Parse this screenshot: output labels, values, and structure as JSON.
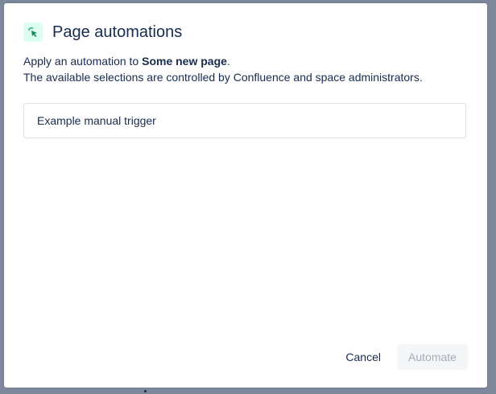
{
  "dialog": {
    "title": "Page automations",
    "icon": "automation-cursor-icon",
    "description_prefix": "Apply an automation to ",
    "page_name": "Some new page",
    "description_suffix": ".",
    "description_line2": "The available selections are controlled by Confluence and space administrators.",
    "options": [
      {
        "label": "Example manual trigger"
      }
    ],
    "cancel_label": "Cancel",
    "automate_label": "Automate"
  },
  "colors": {
    "accent": "#36b37e",
    "icon_bg": "#dcfff1",
    "overlay": "#7d889c"
  }
}
